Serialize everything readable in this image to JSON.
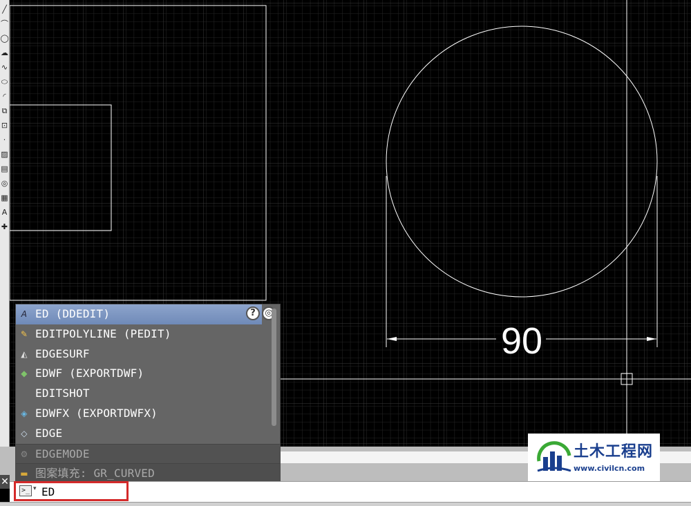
{
  "drawing": {
    "dimension_text": "90"
  },
  "toolbar": {
    "icons": [
      "line-icon",
      "arc-icon",
      "circle-icon",
      "cloud-icon",
      "spline-icon",
      "ellipse-icon",
      "ellipse-arc-icon",
      "insert-block-icon",
      "make-block-icon",
      "point-icon",
      "hatch-icon",
      "gradient-icon",
      "region-icon",
      "table-icon",
      "mtext-icon",
      "add-selected-icon"
    ],
    "text_tool_glyph": "A"
  },
  "autocomplete": {
    "items": [
      {
        "label": "ED (DDEDIT)",
        "icon": "edit-text-icon",
        "glyph": "A",
        "state": "selected"
      },
      {
        "label": "EDITPOLYLINE (PEDIT)",
        "icon": "pedit-icon",
        "glyph": "✎",
        "state": "normal"
      },
      {
        "label": "EDGESURF",
        "icon": "edgesurf-icon",
        "glyph": "◭",
        "state": "normal"
      },
      {
        "label": "EDWF (EXPORTDWF)",
        "icon": "export-dwf-icon",
        "glyph": "◆",
        "state": "normal"
      },
      {
        "label": "EDITSHOT",
        "icon": "",
        "glyph": "",
        "state": "normal"
      },
      {
        "label": "EDWFX (EXPORTDWFX)",
        "icon": "export-dwfx-icon",
        "glyph": "◈",
        "state": "normal"
      },
      {
        "label": "EDGE",
        "icon": "edge-icon",
        "glyph": "◇",
        "state": "normal"
      },
      {
        "label": "EDGEMODE",
        "icon": "gear-icon",
        "glyph": "⚙",
        "state": "dim"
      },
      {
        "label": "图案填充: GR_CURVED",
        "icon": "hatch-pattern-icon",
        "glyph": "▬",
        "state": "dim"
      }
    ],
    "help_glyph": "?",
    "web_glyph": "◎"
  },
  "command_line": {
    "prompt_glyph": ">_",
    "arrow_glyph": "▾",
    "value": "ED",
    "close_glyph": "✕"
  },
  "watermark": {
    "title": "土木工程网",
    "url": "www.civilcn.com"
  },
  "colors": {
    "canvas_bg": "#000000",
    "linework": "#ffffff",
    "grid_minor": "#2b2b2b",
    "grid_major": "#3d3d3d",
    "highlight_border": "#d42a2a",
    "logo_blue": "#1a3f8e",
    "logo_green": "#3aa935"
  }
}
